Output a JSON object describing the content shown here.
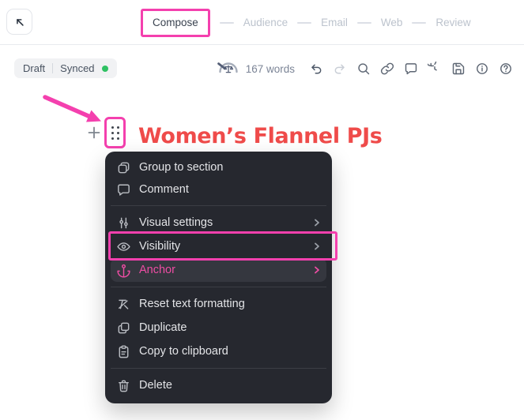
{
  "colors": {
    "annotation_pink": "#f440ae",
    "heading_red": "#ef4b4a",
    "synced_green": "#2fc163",
    "menu_background": "#26282f",
    "anchor_pink": "#ee4da4"
  },
  "header": {
    "back_icon": "arrow-up-left",
    "tabs": [
      {
        "label": "Compose",
        "active": true,
        "annotated": true
      },
      {
        "label": "Audience",
        "active": false
      },
      {
        "label": "Email",
        "active": false
      },
      {
        "label": "Web",
        "active": false
      },
      {
        "label": "Review",
        "active": false
      }
    ]
  },
  "toolbar": {
    "draft_label": "Draft",
    "synced_label": "Synced",
    "word_count": "167 words",
    "gauge_icon": "readability-gauge-icon",
    "icons": [
      "undo-icon",
      "redo-icon",
      "search-icon",
      "link-icon",
      "comment-icon",
      "history-icon",
      "save-icon",
      "info-icon",
      "help-icon"
    ],
    "redo_disabled": true
  },
  "content": {
    "heading": "Women’s Flannel PJs",
    "plus_icon": "plus-icon",
    "drag_handle_icon": "drag-handle-dots-icon"
  },
  "menu": {
    "items": [
      {
        "label": "Group to section",
        "icon": "group-icon"
      },
      {
        "label": "Comment",
        "icon": "comment-icon"
      },
      {
        "label": "Visual settings",
        "icon": "sliders-icon",
        "submenu": true
      },
      {
        "label": "Visibility",
        "icon": "eye-icon",
        "submenu": true,
        "annotated": true
      },
      {
        "label": "Anchor",
        "icon": "anchor-icon",
        "submenu": true,
        "highlighted": true
      },
      {
        "label": "Reset text formatting",
        "icon": "clear-format-icon"
      },
      {
        "label": "Duplicate",
        "icon": "duplicate-icon"
      },
      {
        "label": "Copy to clipboard",
        "icon": "clipboard-icon"
      },
      {
        "label": "Delete",
        "icon": "trash-icon"
      }
    ]
  }
}
